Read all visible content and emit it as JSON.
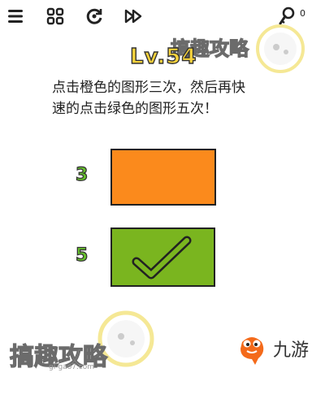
{
  "toolbar": {
    "icons": [
      "menu-icon",
      "levels-grid-icon",
      "restart-icon",
      "skip-icon",
      "hint-key-icon"
    ],
    "hint_count": "0"
  },
  "level": {
    "title": "Lv.54"
  },
  "instruction": {
    "line1": "点击橙色的图形三次，然后再快",
    "line2": "速的点击绿色的图形五次！"
  },
  "shapes": {
    "orange": {
      "count": "3",
      "color": "#fb8a1c"
    },
    "green": {
      "count": "5",
      "color": "#7ab51f"
    }
  },
  "watermark": {
    "text": "搞趣攻略",
    "url": "gl-gao7.com"
  },
  "brand": {
    "name": "九游"
  }
}
